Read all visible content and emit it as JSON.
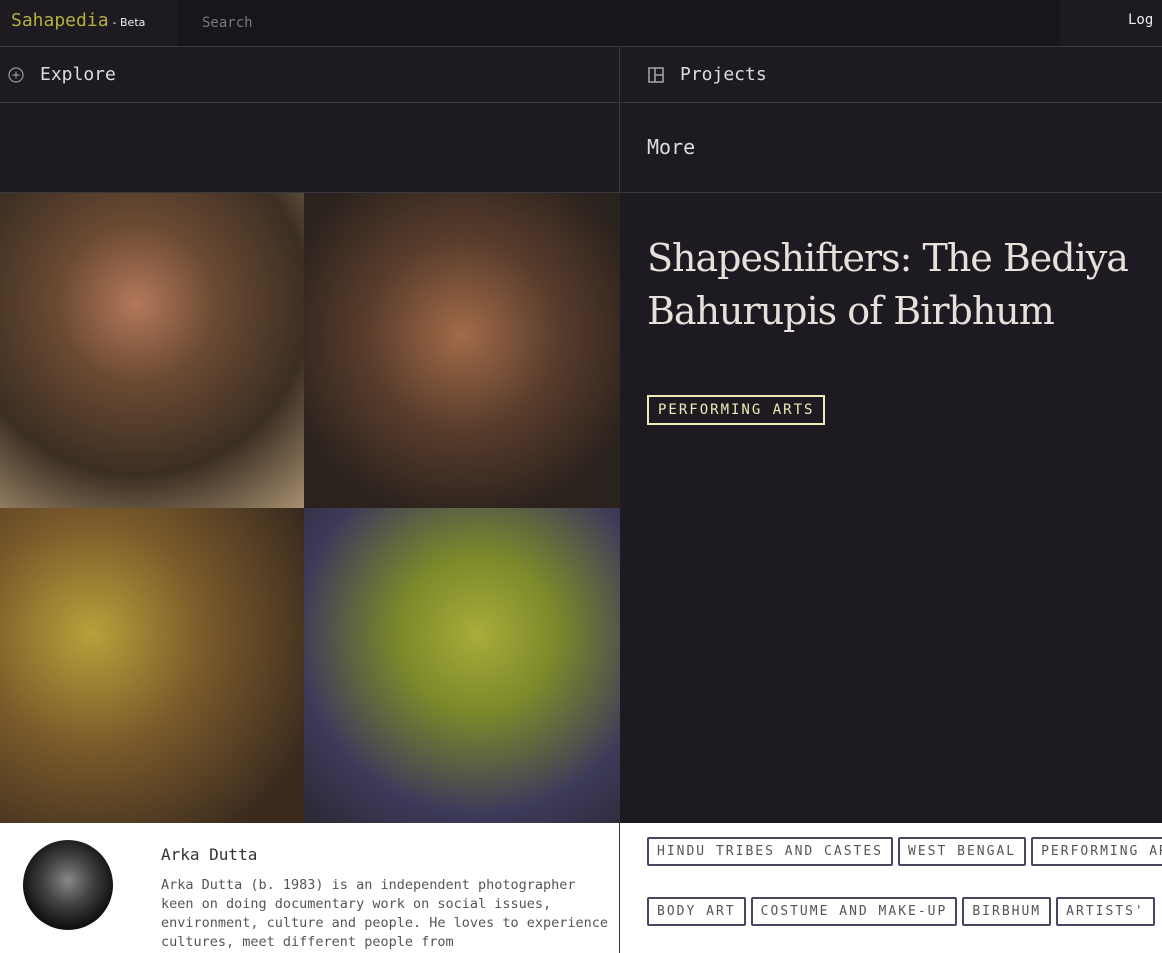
{
  "header": {
    "logo": "Sahapedia",
    "beta": "- Beta",
    "search_placeholder": "Search",
    "login": "Log"
  },
  "nav": {
    "explore": "Explore",
    "projects": "Projects",
    "more": "More"
  },
  "article": {
    "title": "Shapeshifters: The Bediya Bahurupis of Birbhum",
    "category": "PERFORMING ARTS"
  },
  "author": {
    "name": "Arka Dutta",
    "bio": "Arka Dutta (b. 1983) is an independent photographer keen on doing documentary work on social issues, environment, culture and people. He loves to experience cultures, meet different people from"
  },
  "tags_row1": [
    "HINDU TRIBES AND CASTES",
    "WEST BENGAL",
    "PERFORMING ARTS"
  ],
  "tags_row2": [
    "BODY ART",
    "COSTUME AND MAKE-UP",
    "BIRBHUM",
    "ARTISTS'"
  ]
}
